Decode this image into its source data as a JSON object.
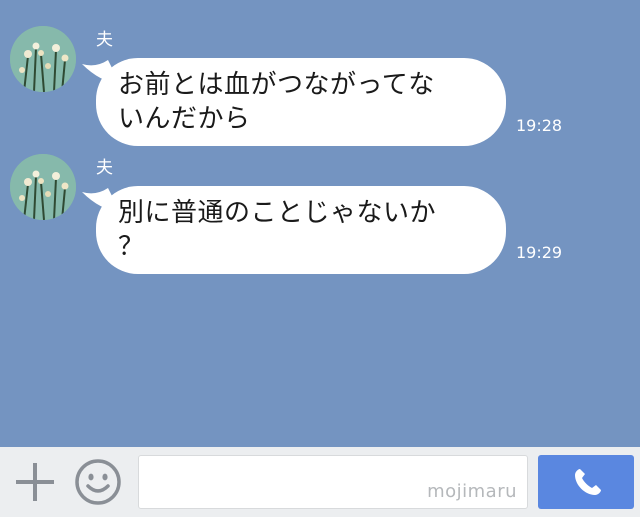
{
  "chat": {
    "messages": [
      {
        "sender": "夫",
        "lines": [
          "お前とは血がつながってな",
          "いんだから"
        ],
        "time": "19:28"
      },
      {
        "sender": "夫",
        "lines": [
          "別に普通のことじゃないか",
          "？"
        ],
        "time": "19:29"
      }
    ]
  },
  "composer": {
    "input_value": "",
    "watermark": "mojimaru"
  },
  "colors": {
    "chat_background": "#7494c1",
    "bubble": "#ffffff",
    "send_button": "#5a87e0",
    "composer_bar": "#eceef0"
  },
  "icons": {
    "add": "plus-icon",
    "sticker": "smiley-icon",
    "call": "phone-icon",
    "avatar": "flower-avatar"
  }
}
